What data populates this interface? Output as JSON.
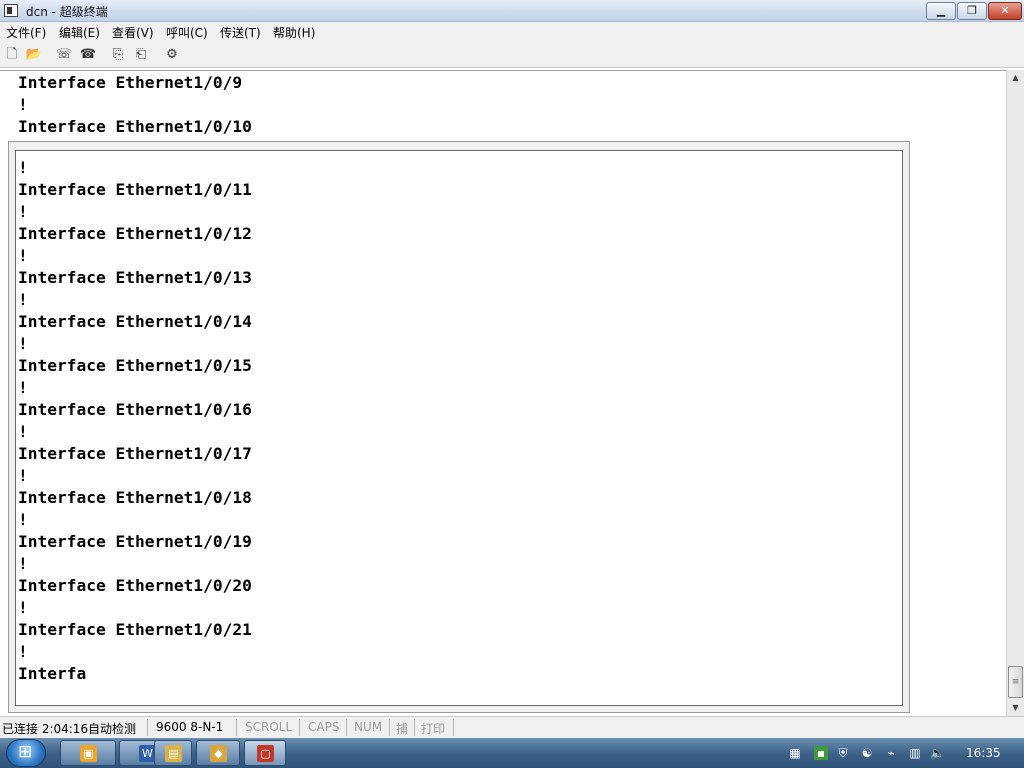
{
  "window": {
    "title": "dcn - 超级终端"
  },
  "menu": [
    "文件(F)",
    "编辑(E)",
    "查看(V)",
    "呼叫(C)",
    "传送(T)",
    "帮助(H)"
  ],
  "toolbar": [
    "new-icon",
    "open-icon",
    "phone-icon",
    "hangup-icon",
    "send-icon",
    "receive-icon",
    "properties-icon"
  ],
  "terminal": {
    "top_lines": [
      "Interface Ethernet1/0/9",
      "!",
      "Interface Ethernet1/0/10"
    ],
    "lines": [
      "!",
      "Interface Ethernet1/0/11",
      "!",
      "Interface Ethernet1/0/12",
      "!",
      "Interface Ethernet1/0/13",
      "!",
      "Interface Ethernet1/0/14",
      "!",
      "Interface Ethernet1/0/15",
      "!",
      "Interface Ethernet1/0/16",
      "!",
      "Interface Ethernet1/0/17",
      "!",
      "Interface Ethernet1/0/18",
      "!",
      "Interface Ethernet1/0/19",
      "!",
      "Interface Ethernet1/0/20",
      "!",
      "Interface Ethernet1/0/21",
      "!",
      "Interfa"
    ]
  },
  "statusbar": {
    "connection": "已连接 2:04:16",
    "detect": "自动检测",
    "settings": "9600 8-N-1",
    "scroll": "SCROLL",
    "caps": "CAPS",
    "num": "NUM",
    "capture": "捕",
    "print": "打印"
  },
  "taskbar": {
    "apps": [
      "folder-app",
      "word-app",
      "explorer-app",
      "package-app",
      "terminal-app"
    ],
    "clock": "16:35"
  },
  "colors": {
    "taskbar": "#3e6288",
    "terminal_bg": "#ffffff",
    "text": "#000000"
  }
}
